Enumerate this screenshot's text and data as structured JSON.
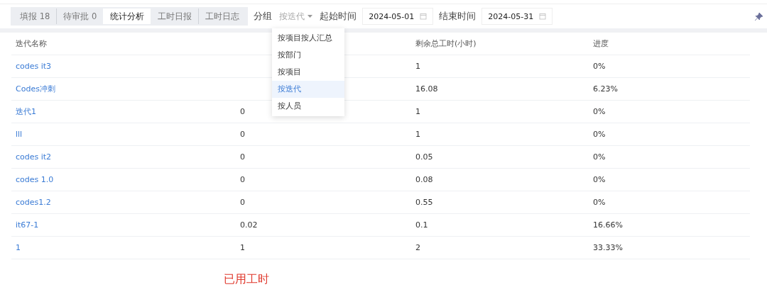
{
  "tabs": [
    {
      "label": "填报 18",
      "selected": false
    },
    {
      "label": "待审批 0",
      "selected": false
    },
    {
      "label": "统计分析",
      "selected": true
    },
    {
      "label": "工时日报",
      "selected": false
    },
    {
      "label": "工时日志",
      "selected": false
    }
  ],
  "group": {
    "label": "分组",
    "value": "按迭代",
    "expanded": true,
    "options": [
      {
        "label": "按项目按人汇总",
        "selected": false
      },
      {
        "label": "按部门",
        "selected": false
      },
      {
        "label": "按项目",
        "selected": false
      },
      {
        "label": "按迭代",
        "selected": true
      },
      {
        "label": "按人员",
        "selected": false
      }
    ]
  },
  "start": {
    "label": "起始时间",
    "value": "2024-05-01"
  },
  "end": {
    "label": "结束时间",
    "value": "2024-05-31"
  },
  "table": {
    "columns": [
      "迭代名称",
      null,
      "剩余总工时(小时)",
      "进度"
    ],
    "rows": [
      [
        "codes it3",
        null,
        "1",
        "0%"
      ],
      [
        "Codes冲刺",
        null,
        "16.08",
        "6.23%"
      ],
      [
        "迭代1",
        "0",
        "1",
        "0%"
      ],
      [
        "lll",
        "0",
        "1",
        "0%"
      ],
      [
        "codes it2",
        "0",
        "0.05",
        "0%"
      ],
      [
        "codes 1.0",
        "0",
        "0.08",
        "0%"
      ],
      [
        "codes1.2",
        "0",
        "0.55",
        "0%"
      ],
      [
        "it67-1",
        "0.02",
        "0.1",
        "16.66%"
      ],
      [
        "1",
        "1",
        "2",
        "33.33%"
      ]
    ]
  },
  "note": "已用工时"
}
